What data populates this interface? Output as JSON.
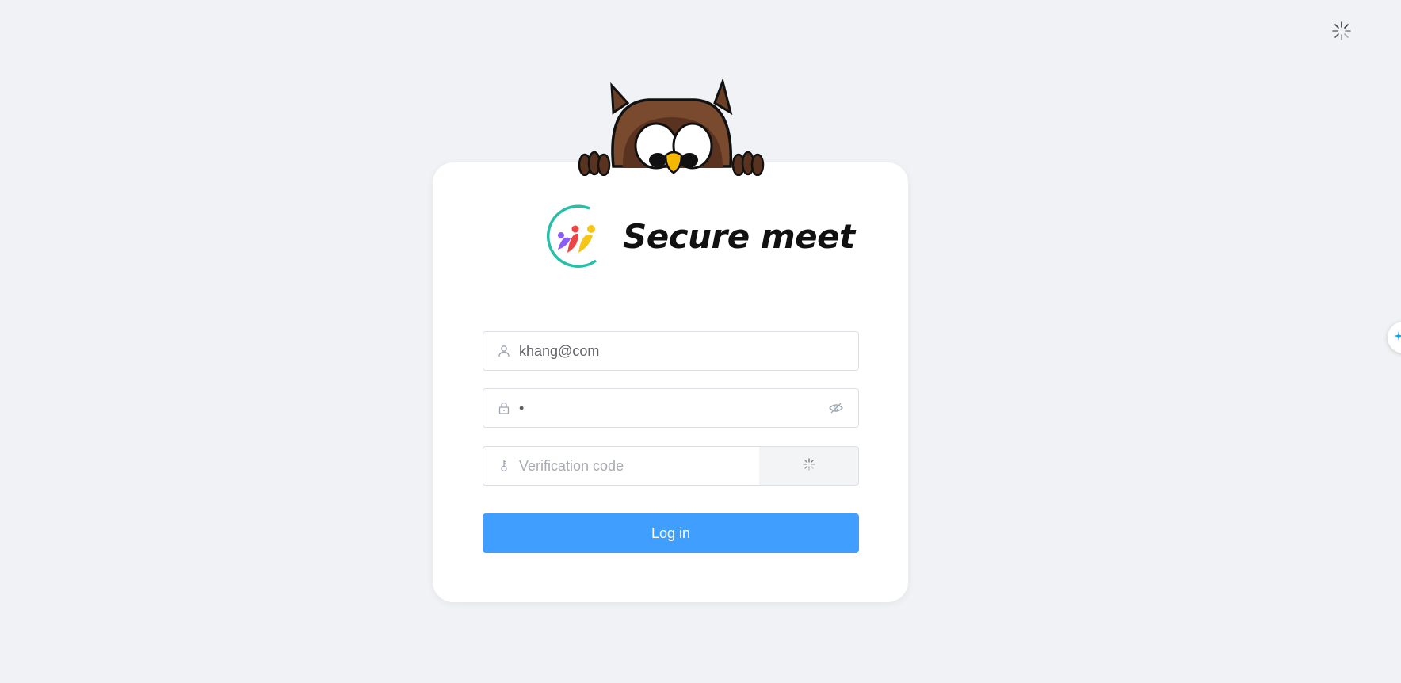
{
  "brand": {
    "name": "Secure meet",
    "logo_icon": "people-circle-logo"
  },
  "form": {
    "username": {
      "value": "khang@com",
      "icon": "user-icon"
    },
    "password": {
      "value": "•",
      "icon": "lock-icon",
      "toggle_icon": "eye-off-icon"
    },
    "verification": {
      "placeholder": "Verification code",
      "icon": "key-icon",
      "captcha_state": "loading-spinner-icon"
    },
    "login_label": "Log in"
  },
  "decor": {
    "mascot": "owl-mascot",
    "top_right_icon": "loading-spinner-icon",
    "side_widget_icon": "sparkle-icon"
  },
  "colors": {
    "background": "#f0f2f5",
    "primary": "#409eff",
    "owl_brown": "#7a4a2e",
    "beak": "#f5b800"
  }
}
